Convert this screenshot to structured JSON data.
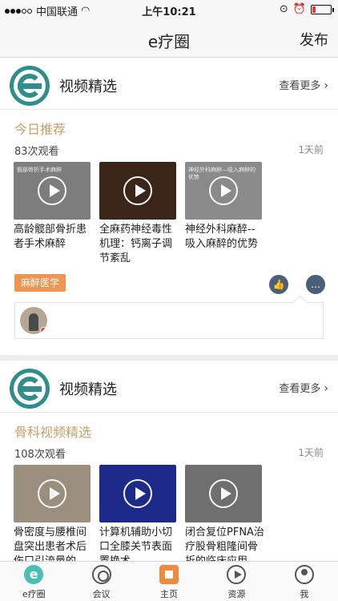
{
  "status_bar": {
    "carrier": "中国联通",
    "time": "上午10:21"
  },
  "nav": {
    "title": "e疗圈",
    "publish": "发布"
  },
  "sections": [
    {
      "title": "视频精选",
      "more": "查看更多",
      "subject": "今日推荐",
      "views": "83次观看",
      "ago": "1天前",
      "videos": [
        {
          "title": "高龄髋部骨折患者手术麻醉",
          "thumb_text": "髋部骨折手术麻醉",
          "color": "#7d7d7d"
        },
        {
          "title": "全麻药神经毒性机理：钙离子调节紊乱",
          "thumb_text": "",
          "color": "#3b2418"
        },
        {
          "title": "神经外科麻醉--吸入麻醉的优势",
          "thumb_text": "神经外科麻醉—吸入麻醉的优势",
          "color": "#8a8a8a"
        }
      ],
      "tag": "麻醉医学"
    },
    {
      "title": "视频精选",
      "more": "查看更多",
      "subject": "骨科视频精选",
      "views": "108次观看",
      "ago": "1天前",
      "videos": [
        {
          "title": "骨密度与腰椎间盘突出患者术后伤口引流量的",
          "thumb_text": "",
          "color": "#9a8e7e"
        },
        {
          "title": "计算机辅助小切口全膝关节表面置换术",
          "thumb_text": "",
          "color": "#1d2a8a"
        },
        {
          "title": "闭合复位PFNA治疗股骨粗隆间骨折的临床应用",
          "thumb_text": "",
          "color": "#6f6f6f"
        }
      ]
    }
  ],
  "tabs": [
    {
      "label": "e疗圈",
      "icon": "e-icon"
    },
    {
      "label": "会议",
      "icon": "meeting-icon"
    },
    {
      "label": "主页",
      "icon": "home-icon"
    },
    {
      "label": "资源",
      "icon": "play-icon"
    },
    {
      "label": "我",
      "icon": "user-icon"
    }
  ]
}
